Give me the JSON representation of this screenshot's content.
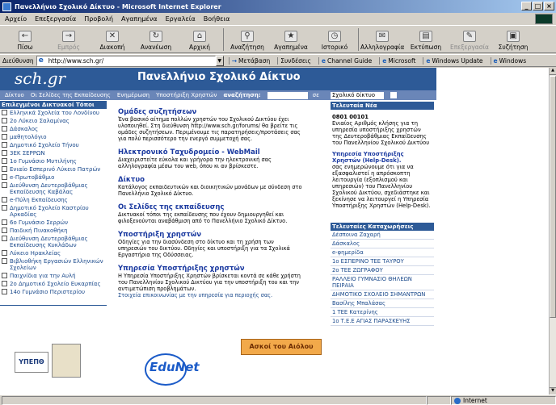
{
  "window": {
    "title": "Πανελλήνιο Σχολικό Δίκτυο - Microsoft Internet Explorer"
  },
  "menu": [
    "Αρχείο",
    "Επεξεργασία",
    "Προβολή",
    "Αγαπημένα",
    "Εργαλεία",
    "Βοήθεια"
  ],
  "toolbar": {
    "back": "Πίσω",
    "forward": "Εμπρός",
    "stop": "Διακοπή",
    "refresh": "Ανανέωση",
    "home": "Αρχική",
    "search": "Αναζήτηση",
    "favorites": "Αγαπημένα",
    "history": "Ιστορικό",
    "mail": "Αλληλογραφία",
    "print": "Εκτύπωση",
    "edit": "Επεξεργασία",
    "discuss": "Συζήτηση"
  },
  "address": {
    "label": "Διεύθυνση",
    "value": "http://www.sch.gr/"
  },
  "links": {
    "go": "Μετάβαση",
    "links": "Συνδέσεις",
    "channel": "Channel Guide",
    "microsoft": "Microsoft",
    "update": "Windows Update",
    "windows": "Windows"
  },
  "page": {
    "logo": "sch.gr",
    "banner_title": "Πανελλήνιο Σχολικό Δίκτυο",
    "nav": [
      "Δίκτυο",
      "Οι Σελίδες της Εκπαίδευσης",
      "Ενημέρωση",
      "Υποστήριξη Χρηστών"
    ],
    "search_label": "αναζήτηση:",
    "search_in": "σε",
    "search_scope": "Σχολικό δίκτυο",
    "left_heading": "Επιλεγμένοι Δικτυακοί Τόποι",
    "left_items": [
      "Ελληνικά Σχολεία του Λονδίνου",
      "2ο Λύκειο Σαλαμίνας",
      "Δάσκαλος",
      "μαθητολόγιο",
      "Δημοτικό Σχολείο Τήνου",
      "3ΕΚ ΣΕΡΡΩΝ",
      "1ο Γυμνάσιο Μυτιλήνης",
      "Ενιαίο Εσπερινό Λύκειο Πατρών",
      "e-Πρωτοβάθμιο",
      "Διεύθυνση Δευτεροβάθμιας Εκπαίδευσης Καβάλας",
      "e-Πύλη Εκπαίδευσης",
      "Δημοτικό Σχολείο Καστρίου Αρκαδίας",
      "6ο Γυμνάσιο Σερρών",
      "Παιδική Πινακοθήκη",
      "Διεύθυνση Δευτεροβάθμιας Εκπαίδευσης Κυκλάδων",
      "Λύκειο Ηρακλείας",
      "Βιβλιοθήκη Εργασιών Ελληνικών Σχολείων",
      "Παιχνίδια για την Αυλή",
      "2ο Δημοτικό Σχολείο Ευκαρπίας",
      "14ο Γυμνάσιο Περιστερίου"
    ],
    "main": [
      {
        "title": "Ομάδες συζητήσεων",
        "text": "Ένα βασικό αίτημα πολλών χρηστών του Σχολικού Δικτύου έχει υλοποιηθεί. Στη διεύθυνση http://www.sch.gr/forums/ θα βρείτε τις ομάδες συζητήσεων. Περιμένουμε τις παρατηρήσεις/προτάσεις σας για πολύ περισσότερο την ενεργό συμμετοχή σας."
      },
      {
        "title": "Ηλεκτρονικό Ταχυδρομείο - WebMail",
        "text": "Διαχειριστείτε εύκολα και γρήγορα την ηλεκτρονική σας αλληλογραφία μέσω του web, όπου κι αν βρίσκεστε."
      },
      {
        "title": "Δίκτυο",
        "text": "Κατάλογος εκπαιδευτικών και διοικητικών μονάδων με σύνδεση στο Πανελλήνιο Σχολικό Δίκτυο."
      },
      {
        "title": "Οι Σελίδες της εκπαίδευσης",
        "text": "Δικτυακοί τόποι της εκπαίδευσης που έχουν δημιουργηθεί και φιλοξενούνται αναβάθμιση από το Πανελλήνιο Σχολικό Δίκτυο."
      },
      {
        "title": "Υποστήριξη χρηστών",
        "text": "Οδηγίες για την διασύνδεση στο δίκτυο και τη χρήση των υπηρεσιών του δικτύου. Οδηγίες και υποστήριξη για τα Σχολικά Εργαστήρια της Οδύσσειας."
      },
      {
        "title": "Υπηρεσία Υποστήριξης χρηστών",
        "text": "Η Υπηρεσία Υποστήριξης Χρηστών βρίσκεται κοντά σε κάθε χρήστη του Πανελληνίου Σχολικού Δικτύου για την υποστήριξη του και την αντιμετώπιση προβλημάτων.",
        "link": "Στοιχεία επικοινωνίας με την υπηρεσία για περιοχής σας."
      }
    ],
    "news_heading": "Τελευταία Νέα",
    "news": {
      "date": "0801 00101",
      "text1": "Ενιαίος Αριθμός κλήσης για τη υπηρεσία υποστήριξης χρηστών της Δευτεροβάθμιας Εκπαίδευσης του Πανελληνίου Σχολικού Δικτύου",
      "title2": "Υπηρεσία Υποστήριξης Χρηστών (Help-Desk).",
      "text2": "σας ενημερώνουμε ότι για να εξασφαλιστεί η απρόσκοπτη λειτουργία (εξοπλισμού και υπηρεσιών) του Πανελληνίου Σχολικού Δικτύου, σχεδιάστηκε και ξεκίνησε να λειτουργεί η Υπηρεσία Υποστήριξης Χρηστών (Help-Desk)."
    },
    "reg_heading": "Τελευταίες Καταχωρήσεις",
    "registrations": [
      "Δέσποινα Ζαχαρή",
      "Δάσκαλος",
      "e-φημερίδα",
      "1ο ΕΣΠΕΡΙΝΟ ΤΕΕ ΤΑΥΡΟΥ",
      "2ο ΤΕΕ ΖΩΓΡΑΦΟΥ",
      "ΡΑΛΛΕΙΟ ΓΥΜΝΑΣΙΟ ΘΗΛΕΩΝ ΠΕΙΡΑΙΑ",
      "ΔΗΜΟΤΙΚΟ ΣΧΟΛΕΙΟ ΣΗΜΑΝΤΡΩΝ",
      "Βασίλης Μπαλάσας",
      "1 ΤΕΕ Κατερίνης",
      "1ο Τ.Ε.Ε ΑΓΙΑΣ ΠΑΡΑΣΚΕΥΗΣ"
    ],
    "logo_ytp": "ΥΠΕΠΘ",
    "edunet": "EduNet",
    "askoi": "Ασκοί του Αιόλου"
  },
  "status": {
    "zone": "Internet"
  }
}
